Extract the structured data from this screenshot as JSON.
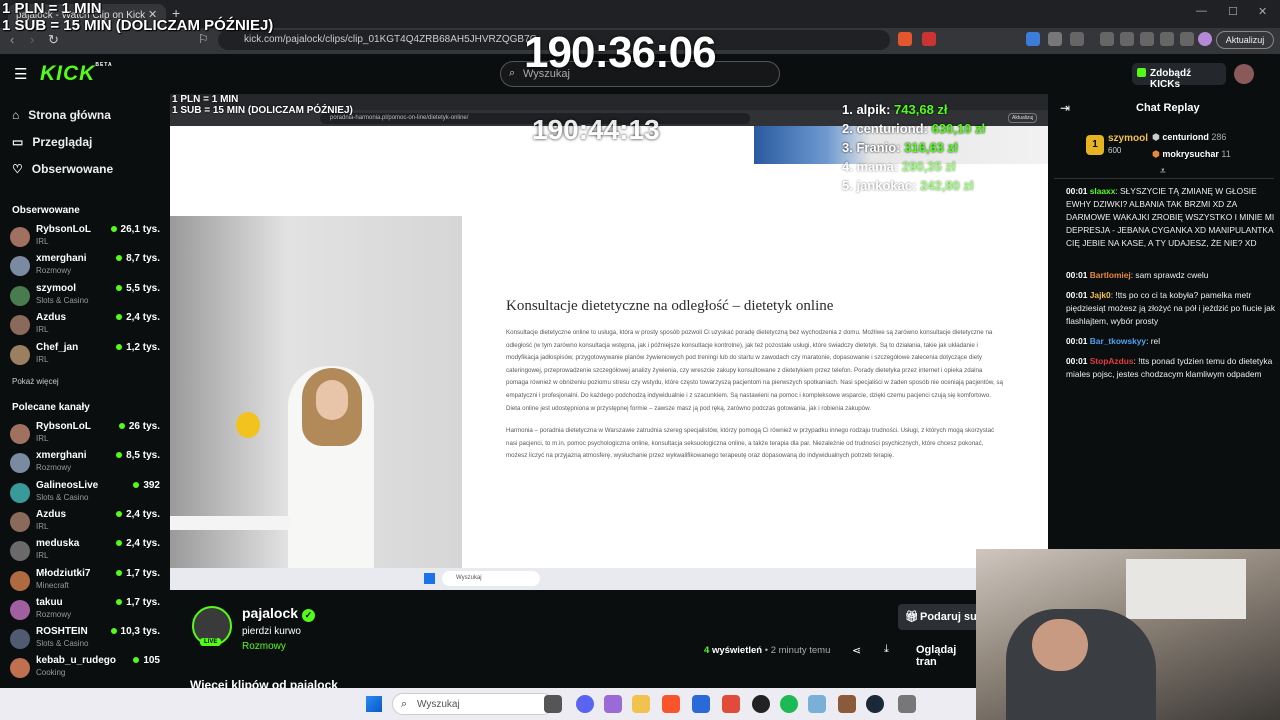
{
  "browser": {
    "tab_title": "pajalock - Watch Clip on Kick",
    "url": "kick.com/pajalock/clips/clip_01KGT4Q4ZRB68AH5JHVRZQGB7G",
    "update_label": "Aktualizuj"
  },
  "stream_overlay": {
    "line1": "1 PLN = 1 MIN",
    "line2": "1 SUB = 15 MIN (DOLICZAM PÓŹNIEJ)",
    "timer": "190:36:06"
  },
  "kick_header": {
    "logo": "KICK",
    "beta": "BETA",
    "search_placeholder": "Wyszukaj",
    "kicks_button": "Zdobądź KICKs"
  },
  "sidebar": {
    "nav": [
      {
        "label": "Strona główna",
        "icon": "home-icon"
      },
      {
        "label": "Przeglądaj",
        "icon": "browse-icon"
      },
      {
        "label": "Obserwowane",
        "icon": "heart-icon"
      }
    ],
    "followed_title": "Obserwowane",
    "followed": [
      {
        "name": "RybsonLoL",
        "category": "IRL",
        "viewers": "26,1 tys.",
        "color": "#a07060"
      },
      {
        "name": "xmerghani",
        "category": "Rozmowy",
        "viewers": "8,7 tys.",
        "color": "#7a8aa0"
      },
      {
        "name": "szymool",
        "category": "Slots & Casino",
        "viewers": "5,5 tys.",
        "color": "#4a7a50"
      },
      {
        "name": "Azdus",
        "category": "IRL",
        "viewers": "2,4 tys.",
        "color": "#8a6a5a"
      },
      {
        "name": "Chef_jan",
        "category": "IRL",
        "viewers": "1,2 tys.",
        "color": "#9a8060"
      }
    ],
    "show_more": "Pokaż więcej",
    "recommended_title": "Polecane kanały",
    "recommended": [
      {
        "name": "RybsonLoL",
        "category": "IRL",
        "viewers": "26 tys.",
        "color": "#a07060"
      },
      {
        "name": "xmerghani",
        "category": "Rozmowy",
        "viewers": "8,5 tys.",
        "color": "#7a8aa0"
      },
      {
        "name": "GalineosLive",
        "category": "Slots & Casino",
        "viewers": "392",
        "color": "#3a9a9a"
      },
      {
        "name": "Azdus",
        "category": "IRL",
        "viewers": "2,4 tys.",
        "color": "#8a6a5a"
      },
      {
        "name": "meduska",
        "category": "IRL",
        "viewers": "2,4 tys.",
        "color": "#6a6a6a"
      },
      {
        "name": "Młodziutki7",
        "category": "Minecraft",
        "viewers": "1,7 tys.",
        "color": "#b06a40"
      },
      {
        "name": "takuu",
        "category": "Rozmowy",
        "viewers": "1,7 tys.",
        "color": "#a060a0"
      },
      {
        "name": "ROSHTEIN",
        "category": "Slots & Casino",
        "viewers": "10,3 tys.",
        "color": "#505a70"
      },
      {
        "name": "kebab_u_rudego",
        "category": "Cooking",
        "viewers": "105",
        "color": "#c07050"
      }
    ]
  },
  "video": {
    "overlay_line1": "1 PLN = 1 MIN",
    "overlay_line2": "1 SUB = 15 MIN (DOLICZAM PÓŹNIEJ)",
    "timer": "190:44:13",
    "inner_url": "poradnia-harmonia.pl/pomoc-on-line/dietetyk-online/",
    "inner_update": "Aktualizuj",
    "inner_search": "Wyszukaj",
    "leaderboard": [
      {
        "label": "1. alpik:",
        "value": "743,68 zł"
      },
      {
        "label": "2. centuriond:",
        "value": "630,10 zł"
      },
      {
        "label": "3. Franio:",
        "value": "316,63 zł"
      },
      {
        "label": "4. mama:",
        "value": "290,35 zł"
      },
      {
        "label": "5. jankokac:",
        "value": "242,80 zł"
      }
    ],
    "article_title": "Konsultacje dietetyczne na odległość – dietetyk online",
    "article_p1": "Konsultacje dietetyczne online to usługa, która w prosty sposób pozwoli Ci uzyskać poradę dietetyczną bez wychodzenia z domu. Możliwe są zarówno konsultacje dietetyczne na odległość (w tym zarówno konsultacja wstępna, jak i późniejsze konsultacje kontrolne), jak też pozostałe usługi, które świadczy dietetyk. Są to działania, takie jak układanie i modyfikacja jadłospisów, przygotowywanie planów żywieniowych pod treningi lub do startu w zawodach czy maratonie, dopasowanie i szczegółowe zalecenia dotyczące diety cateringowej, przeprowadzenie szczegółowej analizy żywienia, czy wreszcie zakupy konsultowane z dietetykiem przez telefon. Porady dietetyka przez internet i opieka zdalna pomaga również w obniżeniu poziomu stresu czy wstydu, które często towarzyszą pacjentom na pierwszych spotkaniach. Nasi specjaliści w żaden sposób nie oceniają pacjentów, są empatyczni i profesjonalni. Do każdego podchodzą indywidualnie i z szacunkiem. Są nastawieni na pomoc i kompleksowe wsparcie, dzięki czemu pacjenci czują się komfortowo. Dieta online jest udostępniona w przystępnej formie – zawsze masz ją pod ręką, zarówno podczas gotowania, jak i robienia zakupów.",
    "article_p2": "Harmonia – poradnia dietetyczna w Warszawie zatrudnia szereg specjalistów, którzy pomogą Ci również w przypadku innego rodzaju trudności. Usługi, z których mogą skorzystać nasi pacjenci, to m.in. pomoc psychologiczna online, konsultacja seksuologiczna online, a także terapia dla par. Niezależnie od trudności psychicznych, które chcesz pokonać, możesz liczyć na przyjazną atmosferę, wysłuchanie przez wykwalifikowanego terapeutę oraz dopasowaną do indywidualnych potrzeb terapię."
  },
  "channel": {
    "name": "pajalock",
    "live_badge": "LIVE",
    "clip_title": "pierdzi kurwo",
    "category": "Rozmowy",
    "views_count": "4",
    "views_label": "wyświetleń",
    "time_ago": "2 minuty temu",
    "gift_button": "Podaruj su",
    "watch_button": "Oglądaj tran",
    "more_clips": "Więcej klipów od pajalock"
  },
  "chat": {
    "title": "Chat Replay",
    "top_gifters": [
      {
        "rank": "1",
        "name": "szymool",
        "amount": "600"
      },
      {
        "rank": "",
        "name": "centuriond",
        "amount": "286"
      },
      {
        "rank": "",
        "name": "mokrysuchar",
        "amount": "11"
      }
    ],
    "messages": [
      {
        "time": "00:01",
        "user": "slaaxx",
        "color": "#53fc18",
        "text": "SŁYSZYCIE TĄ ZMIANĘ W GŁOSIE EWHY DZIWKI? ALBANIA TAK BRZMI XD ZA DARMOWE WAKAJKI ZROBIĘ WSZYSTKO I MINIE MI DEPRESJA - JEBANA CYGANKA XD MANIPULANTKA CIĘ JEBIE NA KASE, A TY UDAJESZ, ŻE NIE? XD"
      },
      {
        "time": "00:01",
        "user": "Bartlomiej",
        "color": "#e8893a",
        "text": "sam sprawdz cwelu"
      },
      {
        "time": "00:01",
        "user": "Jajk0",
        "color": "#f2c14e",
        "text": "!tts po co ci ta kobyła? pamelka metr piędziesiąt możesz ją złożyć na pół i jeździć po fiucie jak flashlajtem, wybór prosty"
      },
      {
        "time": "00:01",
        "user": "Bar_tkowskyy",
        "color": "#4ea2f2",
        "text": "rel"
      },
      {
        "time": "00:01",
        "user": "StopAzdus",
        "color": "#e23b3b",
        "text": "!tts ponad tydzien temu do dietetyka miales pojsc, jestes chodzacym klamliwym odpadem"
      }
    ]
  },
  "taskbar": {
    "search_placeholder": "Wyszukaj"
  }
}
